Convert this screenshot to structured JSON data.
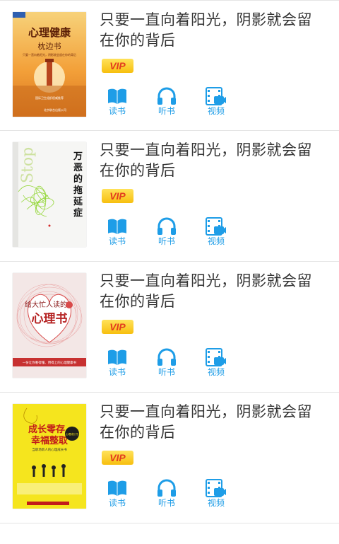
{
  "books": [
    {
      "title": "只要一直向着阳光，阴影就会留在你的背后",
      "vip": "VIP",
      "cover": {
        "main": "心理健康",
        "sub": "枕边书",
        "tagline": "只要一直向着阳光，阴影就会留在你的背后",
        "note": "国际卫生组织权威推荐",
        "publisher": "北京联合出版公司"
      }
    },
    {
      "title": "只要一直向着阳光，阴影就会留在你的背后",
      "vip": "VIP",
      "cover": {
        "main": "万恶的拖延症",
        "side": "Stop Procrastinating"
      }
    },
    {
      "title": "只要一直向着阳光，阴影就会留在你的背后",
      "vip": "VIP",
      "cover": {
        "main_top": "给大忙人读的",
        "main": "心理书",
        "note": "一份让你看得懂、用得上的心理健康书"
      }
    },
    {
      "title": "只要一直向着阳光，阴影就会留在你的背后",
      "vip": "VIP",
      "cover": {
        "line1": "成长零存",
        "line2": "幸福整取",
        "sub": "当职场新人的心理成长书",
        "badge": "心理成长书"
      }
    }
  ],
  "actions": {
    "read": "读书",
    "listen": "听书",
    "video": "视频"
  },
  "colors": {
    "accent": "#1e9de7",
    "vip_text": "#e23c1f",
    "vip_bg": "#f7bf0f",
    "title_text": "#333333",
    "divider": "#e4e4e4"
  },
  "icons": {
    "read": "open-book-icon",
    "listen": "headphones-icon",
    "video": "video-film-icon"
  }
}
